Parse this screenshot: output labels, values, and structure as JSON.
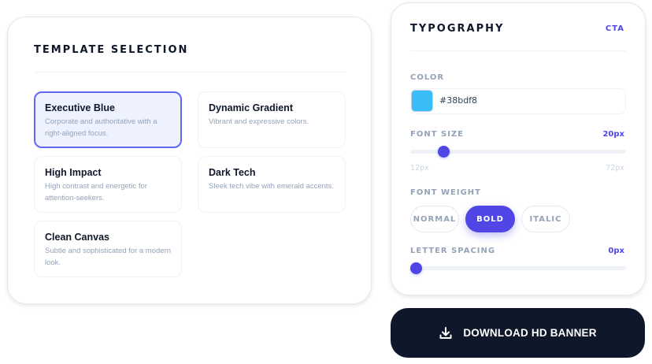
{
  "template_section": {
    "title": "TEMPLATE SELECTION",
    "templates": [
      {
        "name": "Executive Blue",
        "description": "Corporate and authoritative with a right-aligned focus.",
        "selected": true
      },
      {
        "name": "Dynamic Gradient",
        "description": "Vibrant and expressive colors.",
        "selected": false
      },
      {
        "name": "High Impact",
        "description": "High contrast and energetic for attention-seekers.",
        "selected": false
      },
      {
        "name": "Dark Tech",
        "description": "Sleek tech vibe with emerald accents.",
        "selected": false
      },
      {
        "name": "Clean Canvas",
        "description": "Subtle and sophisticated for a modern look.",
        "selected": false
      }
    ]
  },
  "typography": {
    "title": "TYPOGRAPHY",
    "target": "CTA",
    "color": {
      "label": "COLOR",
      "value": "#38bdf8"
    },
    "font_size": {
      "label": "FONT SIZE",
      "value_label": "20px",
      "min_label": "12px",
      "max_label": "72px",
      "value": 20,
      "min": 12,
      "max": 72
    },
    "font_weight": {
      "label": "FONT WEIGHT",
      "options": [
        "NORMAL",
        "BOLD",
        "ITALIC"
      ],
      "selected": "BOLD"
    },
    "letter_spacing": {
      "label": "LETTER SPACING",
      "value_label": "0px",
      "value": 0,
      "min": 0,
      "max": 10
    }
  },
  "download": {
    "label": "DOWNLOAD HD BANNER",
    "icon": "download-icon"
  },
  "colors": {
    "accent": "#4f46e5",
    "selected_border": "#6366f1",
    "selected_bg": "#eef2ff",
    "dark": "#0f172a",
    "muted": "#94a3b8"
  }
}
